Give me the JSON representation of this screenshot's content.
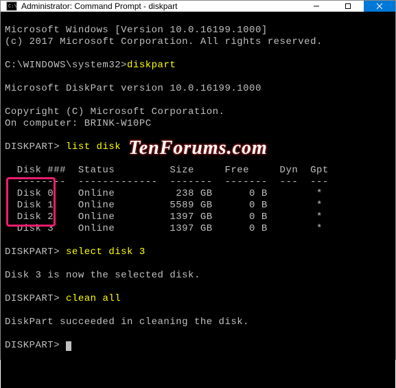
{
  "titlebar": {
    "title": "Administrator: Command Prompt - diskpart"
  },
  "terminal": {
    "banner1": "Microsoft Windows [Version 10.0.16199.1000]",
    "banner2": "(c) 2017 Microsoft Corporation. All rights reserved.",
    "prompt1_path": "C:\\WINDOWS\\system32>",
    "prompt1_cmd": "diskpart",
    "dp_version": "Microsoft DiskPart version 10.0.16199.1000",
    "dp_copyright": "Copyright (C) Microsoft Corporation.",
    "dp_computer": "On computer: BRINK-W10PC",
    "dp_prompt": "DISKPART>",
    "cmd_list": "list disk",
    "header": "  Disk ###  Status         Size     Free     Dyn  Gpt",
    "divider": "  --------  -------------  -------  -------  ---  ---",
    "rows": [
      "  Disk 0    Online          238 GB      0 B        *",
      "  Disk 1    Online         5589 GB      0 B        *",
      "  Disk 2    Online         1397 GB      0 B        *",
      "  Disk 3    Online         1397 GB      0 B        *"
    ],
    "cmd_select": "select disk 3",
    "msg_select": "Disk 3 is now the selected disk.",
    "cmd_clean": "clean all",
    "msg_clean": "DiskPart succeeded in cleaning the disk."
  },
  "watermark": "TenForums.com",
  "chart_data": {
    "type": "table",
    "title": "list disk",
    "columns": [
      "Disk ###",
      "Status",
      "Size",
      "Free",
      "Dyn",
      "Gpt"
    ],
    "rows": [
      {
        "Disk ###": "Disk 0",
        "Status": "Online",
        "Size": "238 GB",
        "Free": "0 B",
        "Dyn": "",
        "Gpt": "*"
      },
      {
        "Disk ###": "Disk 1",
        "Status": "Online",
        "Size": "5589 GB",
        "Free": "0 B",
        "Dyn": "",
        "Gpt": "*"
      },
      {
        "Disk ###": "Disk 2",
        "Status": "Online",
        "Size": "1397 GB",
        "Free": "0 B",
        "Dyn": "",
        "Gpt": "*"
      },
      {
        "Disk ###": "Disk 3",
        "Status": "Online",
        "Size": "1397 GB",
        "Free": "0 B",
        "Dyn": "",
        "Gpt": "*"
      }
    ]
  }
}
